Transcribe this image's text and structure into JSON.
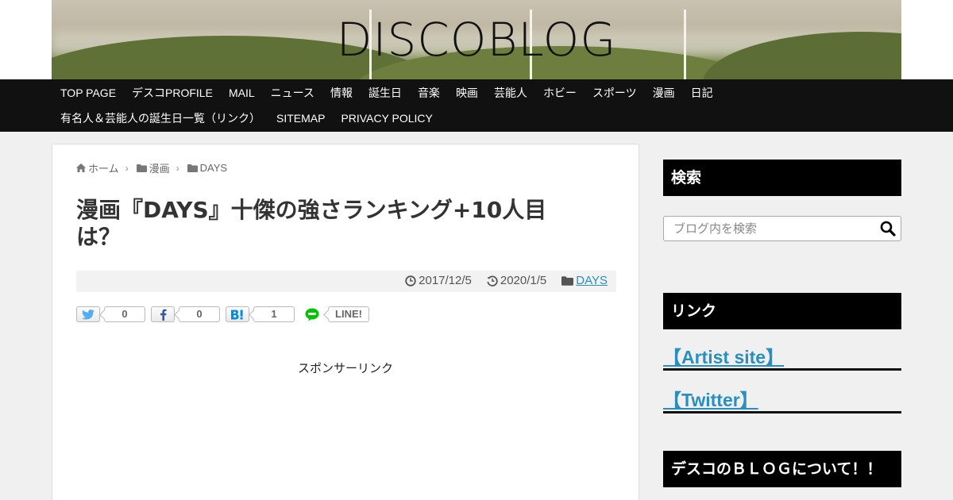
{
  "header": {
    "site_title": "DISCOBLOG"
  },
  "nav": {
    "row1": [
      "TOP PAGE",
      "デスコPROFILE",
      "MAIL",
      "ニュース",
      "情報",
      "誕生日",
      "音楽",
      "映画",
      "芸能人",
      "ホビー",
      "スポーツ",
      "漫画",
      "日記"
    ],
    "row2": [
      "有名人＆芸能人の誕生日一覧（リンク）",
      "SITEMAP",
      "PRIVACY POLICY"
    ]
  },
  "breadcrumb": {
    "home": "ホーム",
    "category": "漫画",
    "subcategory": "DAYS"
  },
  "post": {
    "title": "漫画『DAYS』十傑の強さランキング+10人目は？",
    "published": "2017/12/5",
    "updated": "2020/1/5",
    "category": "DAYS"
  },
  "share": {
    "twitter_count": "0",
    "facebook_count": "0",
    "hatena_count": "1",
    "line_label": "LINE!"
  },
  "sponsor": "スポンサーリンク",
  "sidebar": {
    "search_title": "検索",
    "search_placeholder": "ブログ内を検索",
    "links_title": "リンク",
    "links": [
      "【Artist site】",
      "【Twitter】"
    ],
    "about_title": "デスコのＢＬＯＧについて！！"
  },
  "colors": {
    "link": "#2a8fbd",
    "nav_bg": "#111111",
    "sidebar_head_bg": "#000000"
  }
}
